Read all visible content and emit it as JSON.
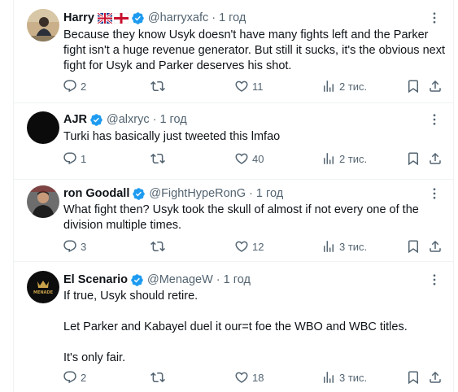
{
  "colors": {
    "text": "#0f1419",
    "secondary": "#536471",
    "verified": "#1d9bf0",
    "border": "#eff3f4"
  },
  "tweets": [
    {
      "name": "Harry",
      "flags": [
        "uk-flag-icon",
        "england-flag-icon"
      ],
      "handle": "@harryxafc",
      "time": "1 год",
      "lines": [
        "Because they know Usyk doesn't have many fights left and the Parker fight isn't a huge revenue generator. But still it sucks, it's the obvious next fight for Usyk and Parker deserves his shot."
      ],
      "replies": "2",
      "retweets": "",
      "likes": "11",
      "views": "2 тис."
    },
    {
      "name": "AJR",
      "handle": "@alxryc",
      "time": "1 год",
      "lines": [
        "Turki has basically just tweeted this lmfao"
      ],
      "replies": "1",
      "retweets": "",
      "likes": "40",
      "views": "2 тис."
    },
    {
      "name": "ron Goodall",
      "handle": "@FightHypeRonG",
      "time": "1 год",
      "lines": [
        "What fight then? Usyk took the skull of almost if not every one of the division multiple times."
      ],
      "replies": "3",
      "retweets": "",
      "likes": "12",
      "views": "3 тис."
    },
    {
      "name": "El Scenario",
      "avatar_text": "MENADE",
      "handle": "@MenageW",
      "time": "1 год",
      "lines": [
        "If true, Usyk should retire.",
        "Let Parker and Kabayel duel it our=t foe the WBO and WBC titles.",
        "It's only fair."
      ],
      "replies": "2",
      "retweets": "",
      "likes": "18",
      "views": "3 тис."
    }
  ]
}
